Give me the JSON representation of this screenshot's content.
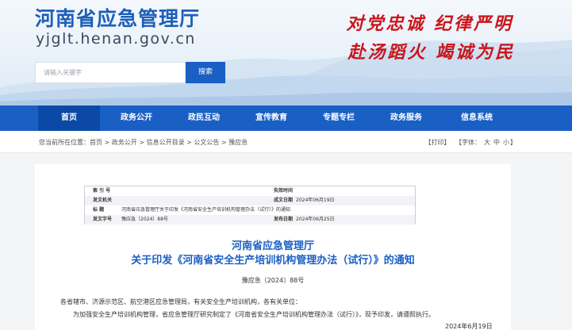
{
  "header": {
    "site_title": "河南省应急管理厅",
    "site_domain": "yjglt.henan.gov.cn",
    "slogan_line1": "对党忠诚 纪律严明",
    "slogan_line2": "赴汤蹈火 竭诚为民"
  },
  "search": {
    "placeholder": "请输入关键字",
    "button_label": "搜索"
  },
  "nav": {
    "items": [
      {
        "label": "首页"
      },
      {
        "label": "政务公开"
      },
      {
        "label": "政民互动"
      },
      {
        "label": "宣传教育"
      },
      {
        "label": "专题专栏"
      },
      {
        "label": "政务服务"
      },
      {
        "label": "信息系统"
      }
    ],
    "active_index": 0
  },
  "breadcrumb": {
    "prefix": "您当前所在位置：",
    "items": [
      "首页",
      "政务公开",
      "信息公开目录",
      "公文公告",
      "豫应急"
    ],
    "separator": " > "
  },
  "tools": {
    "print": "【打印】",
    "font_label": "【字体：",
    "large": "大",
    "medium": "中",
    "small": "小",
    "close": "】"
  },
  "meta": {
    "index_no_label": "索 引 号",
    "index_no_value": "",
    "effect_label": "失效时间",
    "effect_value": "",
    "publisher_label": "发文机关",
    "publisher_value": "",
    "date_label": "成文日期",
    "date_value": "2024年06月19日",
    "title_label": "标    题",
    "title_value": "河南省应急管理厅关于印发《河南省安全生产培训机构管理办法（试行）》的通知",
    "doc_no_label": "发文字号",
    "doc_no_value": "豫应急〔2024〕88号",
    "pub_date_label": "发布日期",
    "pub_date_value": "2024年06月25日"
  },
  "document": {
    "title_line1": "河南省应急管理厅",
    "title_line2": "关于印发《河南省安全生产培训机构管理办法（试行）》的通知",
    "doc_number": "豫应急〔2024〕88号",
    "para1": "各省辖市、济源示范区、航空港区应急管理局，有关安全生产培训机构，各有关单位：",
    "para2": "为加强安全生产培训机构管理，省应急管理厅研究制定了《河南省安全生产培训机构管理办法（试行）》，现予印发，请遵照执行。",
    "date": "2024年6月19日"
  },
  "colors": {
    "brand_blue": "#1a5fc4",
    "nav_active": "#0c49a6",
    "slogan_red": "#c8161d"
  }
}
